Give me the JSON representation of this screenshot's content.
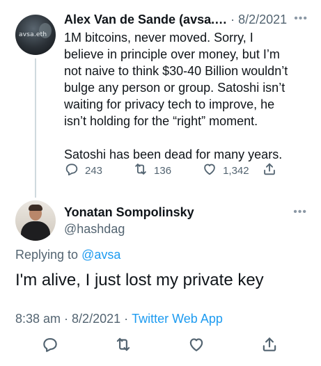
{
  "parent_tweet": {
    "author_name": "Alex Van de Sande (avsa.…",
    "date": "8/2/2021",
    "avatar_label": "avsa.eth",
    "text": "1M bitcoins, never moved. Sorry, I believe in principle over money, but I’m not naive to think $30-40 Billion wouldn’t bulge any person or group. Satoshi isn’t waiting for privacy tech to improve, he isn’t holding for the “right” moment.\n\nSatoshi has been dead for many years.",
    "replies": "243",
    "retweets": "136",
    "likes": "1,342",
    "more_icon": "more-horizontal-icon"
  },
  "reply_tweet": {
    "author_name": "Yonatan Sompolinsky",
    "handle": "@hashdag",
    "replying_prefix": "Replying to",
    "replying_to": "@avsa",
    "text": "I'm alive, I just lost my private key",
    "time": "8:38 am",
    "date": "8/2/2021",
    "source": "Twitter Web App"
  },
  "icons": {
    "reply": "reply-icon",
    "retweet": "retweet-icon",
    "like": "heart-icon",
    "share": "share-icon"
  },
  "colors": {
    "text": "#0f1419",
    "muted": "#536471",
    "link": "#1d9bf0",
    "thread_line": "#cfd9de"
  }
}
